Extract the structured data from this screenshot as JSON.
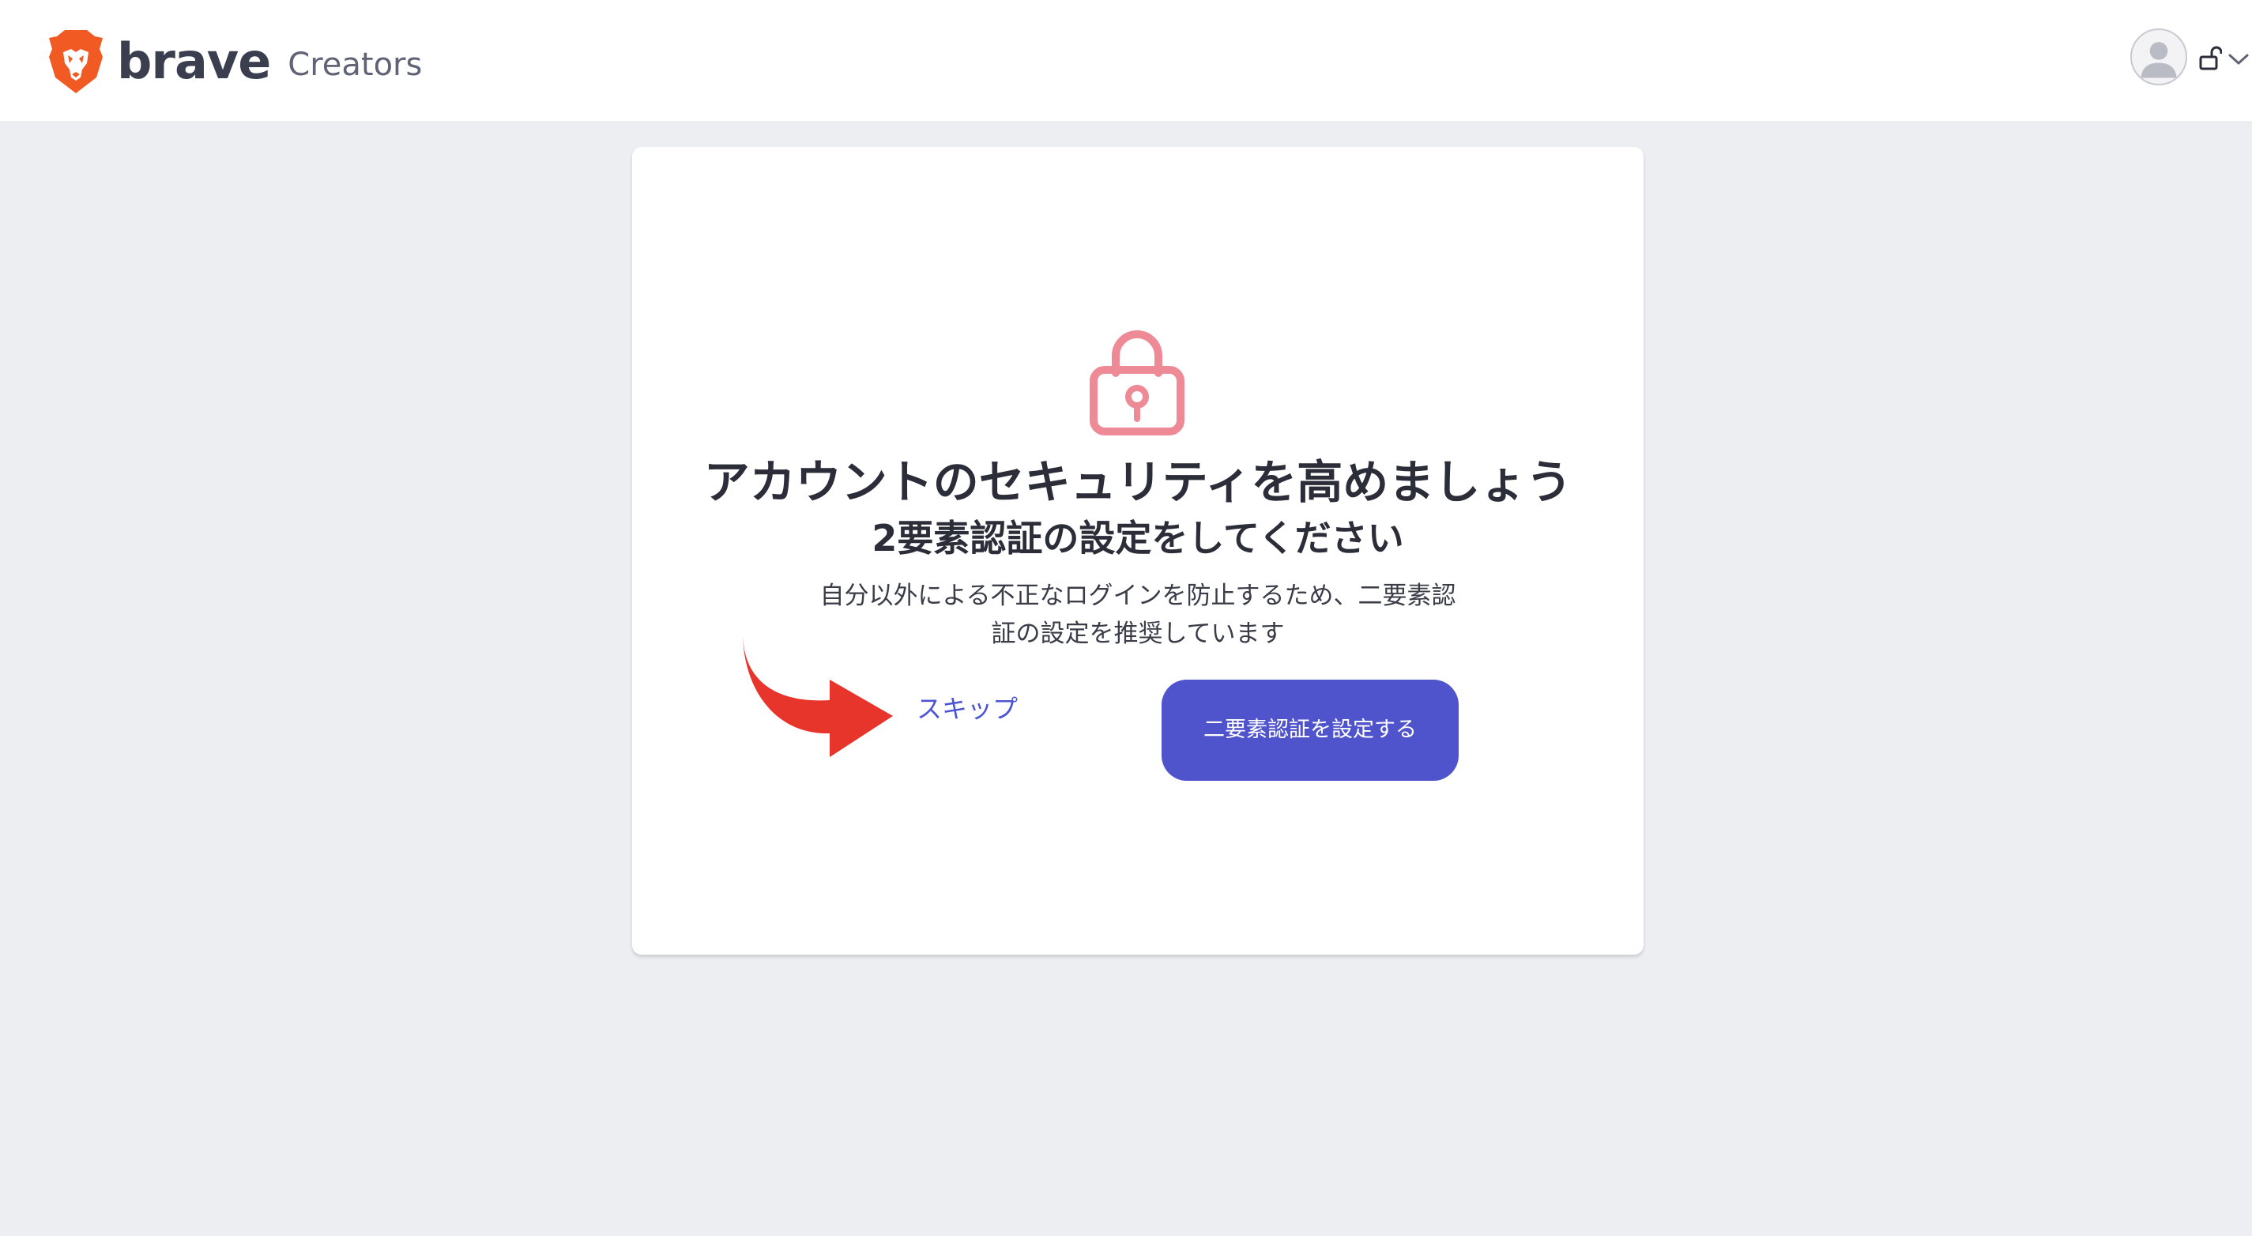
{
  "header": {
    "brand_name": "brave",
    "brand_product": "Creators",
    "user_menu": {
      "avatar_icon": "user-avatar-icon",
      "lock_icon": "unlocked-padlock-icon",
      "chevron_icon": "chevron-down-icon"
    }
  },
  "main": {
    "lock_icon": "padlock-icon",
    "title": "アカウントのセキュリティを高めましょう",
    "subtitle": "2要素認証の設定をしてください",
    "description": "自分以外による不正なログインを防止するため、二要素認証の設定を推奨しています",
    "skip_label": "スキップ",
    "setup_button_label": "二要素認証を設定する"
  },
  "annotation": {
    "arrow_icon": "red-curved-arrow",
    "arrow_color": "#e8352b"
  },
  "colors": {
    "accent": "#5054cc",
    "link": "#4c54d2",
    "lock_icon": "#ee8a96",
    "background": "#eceef1",
    "brand_orange": "#f15a23"
  }
}
